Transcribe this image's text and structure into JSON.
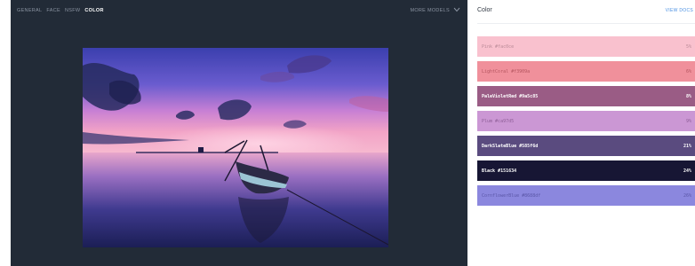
{
  "tabs": [
    {
      "label": "GENERAL",
      "active": false
    },
    {
      "label": "FACE",
      "active": false
    },
    {
      "label": "NSFW",
      "active": false
    },
    {
      "label": "COLOR",
      "active": true
    }
  ],
  "more_models": {
    "label": "MORE MODELS",
    "icon": "chevron-down-icon"
  },
  "image": {
    "description_icon": "sunset-boat-photo"
  },
  "panel": {
    "title": "Color",
    "view_docs": "VIEW DOCS"
  },
  "colors": [
    {
      "label": "Pink  #fac0ce",
      "percent": "5%",
      "bg": "#f9c1ce",
      "fg": "#b98a97",
      "bold": false
    },
    {
      "label": "LightCoral  #f3909a",
      "percent": "6%",
      "bg": "#f0909b",
      "fg": "#b4555f",
      "bold": false
    },
    {
      "label": "PaleVioletRed  #9a5c85",
      "percent": "8%",
      "bg": "#9a5c85",
      "fg": "#ffffff",
      "bold": true
    },
    {
      "label": "Plum  #ca97d5",
      "percent": "9%",
      "bg": "#cb97d4",
      "fg": "#8e5e97",
      "bold": false
    },
    {
      "label": "DarkSlateBlue  #585f6d",
      "percent": "21%",
      "bg": "#5a4b7f",
      "fg": "#ffffff",
      "bold": true
    },
    {
      "label": "Black  #151634",
      "percent": "24%",
      "bg": "#171634",
      "fg": "#ffffff",
      "bold": true
    },
    {
      "label": "CornflowerBlue  #8688df",
      "percent": "26%",
      "bg": "#8b87de",
      "fg": "#5b57a8",
      "bold": false
    }
  ]
}
